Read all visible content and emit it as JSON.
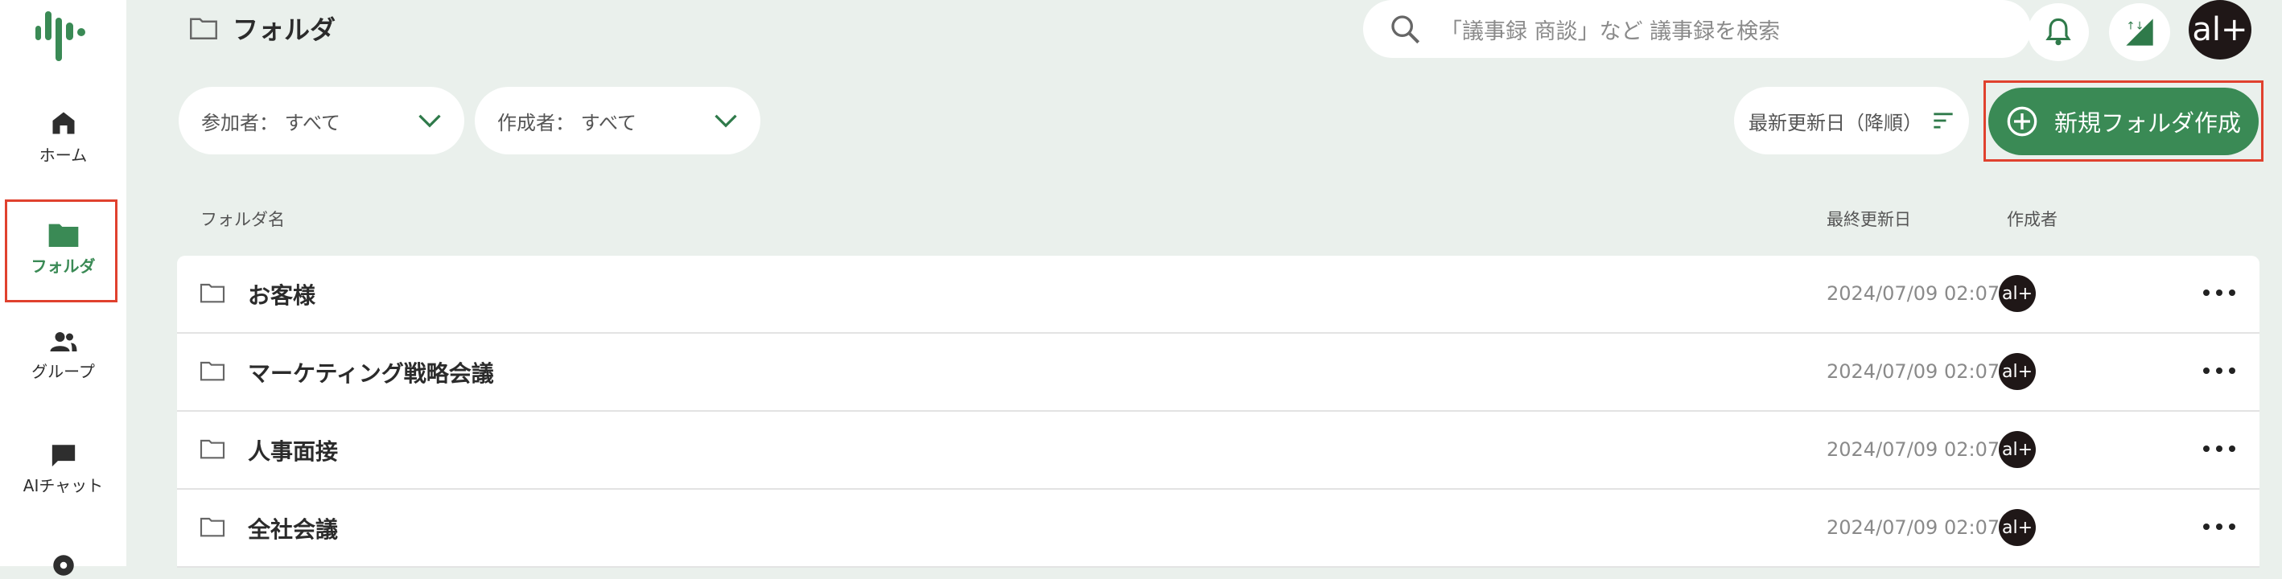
{
  "sidebar": {
    "items": [
      {
        "label": "ホーム",
        "icon": "home-icon"
      },
      {
        "label": "フォルダ",
        "icon": "folder-icon",
        "active": true
      },
      {
        "label": "グループ",
        "icon": "group-icon"
      },
      {
        "label": "AIチャット",
        "icon": "chat-icon"
      },
      {
        "icon": "gear-icon"
      }
    ]
  },
  "header": {
    "title": "フォルダ",
    "search_placeholder": "「議事録 商談」など 議事録を検索",
    "avatar_text": "al+"
  },
  "filters": {
    "participant": "参加者： すべて",
    "creator": "作成者： すべて",
    "sort": "最新更新日（降順）",
    "new_folder": "新規フォルダ作成"
  },
  "table": {
    "columns": [
      "フォルダ名",
      "最終更新日",
      "作成者"
    ],
    "rows": [
      {
        "name": "お客様",
        "date": "2024/07/09 02:07",
        "creator": "al+"
      },
      {
        "name": "マーケティング戦略会議",
        "date": "2024/07/09 02:07",
        "creator": "al+"
      },
      {
        "name": "人事面接",
        "date": "2024/07/09 02:07",
        "creator": "al+"
      },
      {
        "name": "全社会議",
        "date": "2024/07/09 02:07",
        "creator": "al+"
      }
    ]
  },
  "colors": {
    "accent": "#3a8a55",
    "background": "#eaf0ec",
    "highlight": "#e0412e"
  }
}
